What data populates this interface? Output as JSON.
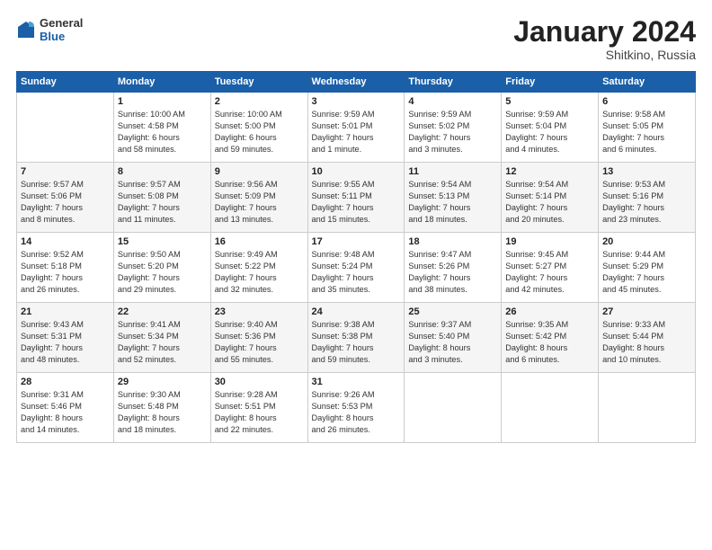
{
  "header": {
    "logo_general": "General",
    "logo_blue": "Blue",
    "month_title": "January 2024",
    "location": "Shitkino, Russia"
  },
  "days_of_week": [
    "Sunday",
    "Monday",
    "Tuesday",
    "Wednesday",
    "Thursday",
    "Friday",
    "Saturday"
  ],
  "weeks": [
    [
      {
        "day": "",
        "info": ""
      },
      {
        "day": "1",
        "info": "Sunrise: 10:00 AM\nSunset: 4:58 PM\nDaylight: 6 hours\nand 58 minutes."
      },
      {
        "day": "2",
        "info": "Sunrise: 10:00 AM\nSunset: 5:00 PM\nDaylight: 6 hours\nand 59 minutes."
      },
      {
        "day": "3",
        "info": "Sunrise: 9:59 AM\nSunset: 5:01 PM\nDaylight: 7 hours\nand 1 minute."
      },
      {
        "day": "4",
        "info": "Sunrise: 9:59 AM\nSunset: 5:02 PM\nDaylight: 7 hours\nand 3 minutes."
      },
      {
        "day": "5",
        "info": "Sunrise: 9:59 AM\nSunset: 5:04 PM\nDaylight: 7 hours\nand 4 minutes."
      },
      {
        "day": "6",
        "info": "Sunrise: 9:58 AM\nSunset: 5:05 PM\nDaylight: 7 hours\nand 6 minutes."
      }
    ],
    [
      {
        "day": "7",
        "info": "Sunrise: 9:57 AM\nSunset: 5:06 PM\nDaylight: 7 hours\nand 8 minutes."
      },
      {
        "day": "8",
        "info": "Sunrise: 9:57 AM\nSunset: 5:08 PM\nDaylight: 7 hours\nand 11 minutes."
      },
      {
        "day": "9",
        "info": "Sunrise: 9:56 AM\nSunset: 5:09 PM\nDaylight: 7 hours\nand 13 minutes."
      },
      {
        "day": "10",
        "info": "Sunrise: 9:55 AM\nSunset: 5:11 PM\nDaylight: 7 hours\nand 15 minutes."
      },
      {
        "day": "11",
        "info": "Sunrise: 9:54 AM\nSunset: 5:13 PM\nDaylight: 7 hours\nand 18 minutes."
      },
      {
        "day": "12",
        "info": "Sunrise: 9:54 AM\nSunset: 5:14 PM\nDaylight: 7 hours\nand 20 minutes."
      },
      {
        "day": "13",
        "info": "Sunrise: 9:53 AM\nSunset: 5:16 PM\nDaylight: 7 hours\nand 23 minutes."
      }
    ],
    [
      {
        "day": "14",
        "info": "Sunrise: 9:52 AM\nSunset: 5:18 PM\nDaylight: 7 hours\nand 26 minutes."
      },
      {
        "day": "15",
        "info": "Sunrise: 9:50 AM\nSunset: 5:20 PM\nDaylight: 7 hours\nand 29 minutes."
      },
      {
        "day": "16",
        "info": "Sunrise: 9:49 AM\nSunset: 5:22 PM\nDaylight: 7 hours\nand 32 minutes."
      },
      {
        "day": "17",
        "info": "Sunrise: 9:48 AM\nSunset: 5:24 PM\nDaylight: 7 hours\nand 35 minutes."
      },
      {
        "day": "18",
        "info": "Sunrise: 9:47 AM\nSunset: 5:26 PM\nDaylight: 7 hours\nand 38 minutes."
      },
      {
        "day": "19",
        "info": "Sunrise: 9:45 AM\nSunset: 5:27 PM\nDaylight: 7 hours\nand 42 minutes."
      },
      {
        "day": "20",
        "info": "Sunrise: 9:44 AM\nSunset: 5:29 PM\nDaylight: 7 hours\nand 45 minutes."
      }
    ],
    [
      {
        "day": "21",
        "info": "Sunrise: 9:43 AM\nSunset: 5:31 PM\nDaylight: 7 hours\nand 48 minutes."
      },
      {
        "day": "22",
        "info": "Sunrise: 9:41 AM\nSunset: 5:34 PM\nDaylight: 7 hours\nand 52 minutes."
      },
      {
        "day": "23",
        "info": "Sunrise: 9:40 AM\nSunset: 5:36 PM\nDaylight: 7 hours\nand 55 minutes."
      },
      {
        "day": "24",
        "info": "Sunrise: 9:38 AM\nSunset: 5:38 PM\nDaylight: 7 hours\nand 59 minutes."
      },
      {
        "day": "25",
        "info": "Sunrise: 9:37 AM\nSunset: 5:40 PM\nDaylight: 8 hours\nand 3 minutes."
      },
      {
        "day": "26",
        "info": "Sunrise: 9:35 AM\nSunset: 5:42 PM\nDaylight: 8 hours\nand 6 minutes."
      },
      {
        "day": "27",
        "info": "Sunrise: 9:33 AM\nSunset: 5:44 PM\nDaylight: 8 hours\nand 10 minutes."
      }
    ],
    [
      {
        "day": "28",
        "info": "Sunrise: 9:31 AM\nSunset: 5:46 PM\nDaylight: 8 hours\nand 14 minutes."
      },
      {
        "day": "29",
        "info": "Sunrise: 9:30 AM\nSunset: 5:48 PM\nDaylight: 8 hours\nand 18 minutes."
      },
      {
        "day": "30",
        "info": "Sunrise: 9:28 AM\nSunset: 5:51 PM\nDaylight: 8 hours\nand 22 minutes."
      },
      {
        "day": "31",
        "info": "Sunrise: 9:26 AM\nSunset: 5:53 PM\nDaylight: 8 hours\nand 26 minutes."
      },
      {
        "day": "",
        "info": ""
      },
      {
        "day": "",
        "info": ""
      },
      {
        "day": "",
        "info": ""
      }
    ]
  ]
}
